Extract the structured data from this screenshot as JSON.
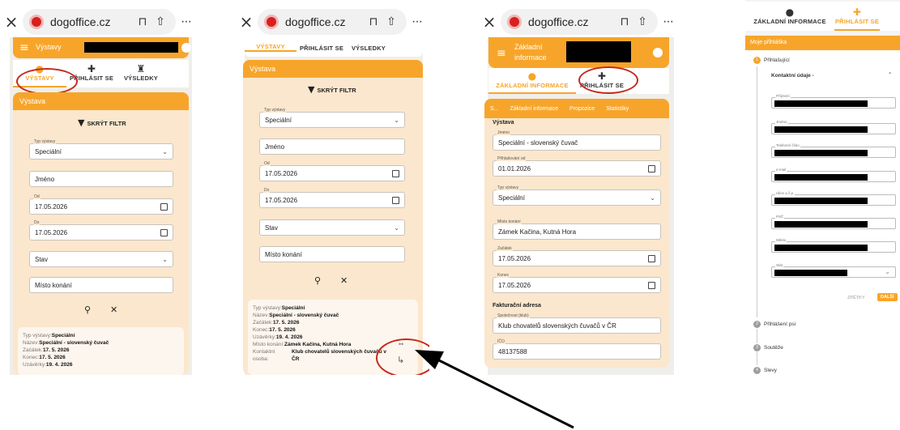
{
  "browser": {
    "close": "×",
    "url": "dogoffice.cz",
    "bookmark": "⊓",
    "share": "⇧",
    "more": "···"
  },
  "tabs": {
    "vystavy": "VÝSTAVY",
    "prihlasit": "PŘIHLÁSIT SE",
    "vysledky": "VÝSLEDKY",
    "zakladni": "ZÁKLADNÍ INFORMACE"
  },
  "panel1": {
    "header_title": "Výstavy",
    "card_title": "Výstava",
    "filter_label": "SKRÝT FILTR",
    "type_label": "Typ výstavy",
    "type_value": "Speciální",
    "name_placeholder": "Jméno",
    "from_label": "Od",
    "from_value": "17.05.2026",
    "to_label": "Do",
    "to_value": "17.05.2026",
    "state_value": "Stav",
    "place_placeholder": "Místo konání",
    "result": {
      "k1": "Typ výstavy:",
      "v1": "Speciální",
      "k2": "Název:",
      "v2": "Speciální - slovenský čuvač",
      "k3": "Začátek:",
      "v3": "17. 5. 2026",
      "k4": "Konec:",
      "v4": "17. 5. 2026",
      "k5": "Uzávěrky:",
      "v5": "19. 4. 2026"
    }
  },
  "panel2": {
    "card_title": "Výstava",
    "filter_label": "SKRÝT FILTR",
    "type_label": "Typ výstavy",
    "type_value": "Speciální",
    "name_placeholder": "Jméno",
    "from_label": "Od",
    "from_value": "17.05.2026",
    "to_label": "Do",
    "to_value": "17.05.2026",
    "state_value": "Stav",
    "place_placeholder": "Místo konání",
    "result": {
      "k1": "Typ výstavy:",
      "v1": "Speciální",
      "k2": "Název:",
      "v2": "Speciální - slovenský čuvač",
      "k3": "Začátek:",
      "v3": "17. 5. 2026",
      "k4": "Konec:",
      "v4": "17. 5. 2026",
      "k5": "Uzávěrky:",
      "v5": "19. 4. 2026",
      "k6": "Místo konání:",
      "v6": "Zámek Kačina, Kutná Hora",
      "k7": "Kontaktní osoba:",
      "v7": "Klub chovatelů slovenských čuvačů v ČR"
    }
  },
  "panel3": {
    "header_title_1": "Základní",
    "header_title_2": "informace",
    "subtab_s": "S...",
    "subtab_zakladni": "Základní informace",
    "subtab_propozice": "Propozice",
    "subtab_statistiky": "Statistiky",
    "section_vystava": "Výstava",
    "f_name_label": "Jméno",
    "f_name_value": "Speciální - slovenský čuvač",
    "f_reg_label": "Přihlašování od",
    "f_reg_value": "01.01.2026",
    "f_type_label": "Typ výstavy",
    "f_type_value": "Speciální",
    "f_place_label": "Místo konání",
    "f_place_value": "Zámek Kačina, Kutná Hora",
    "f_start_label": "Začátek",
    "f_start_value": "17.05.2026",
    "f_end_label": "Konec",
    "f_end_value": "17.05.2026",
    "section_fakt": "Fakturační adresa",
    "f_company_label": "Společnost (klub)",
    "f_company_value": "Klub chovatelů slovenských čuvačů v ČR",
    "f_ico_label": "IČO",
    "f_ico_value": "48137588"
  },
  "panel4": {
    "header_title": "Moje přihláška",
    "step1": "Přihlašující",
    "contact": "Kontaktní údaje -",
    "fields": [
      "Příjmení",
      "Jméno",
      "Telefonní číslo",
      "e-mail",
      "Ulice a č.p.",
      "PSČ",
      "Město",
      "Stát"
    ],
    "btn_back": "ZPĚTKY",
    "btn_next": "DALŠÍ",
    "step2": "Přihlášení psi",
    "step3": "Soutěže",
    "step4": "Slevy",
    "n2": "2",
    "n3": "3",
    "n4": "4",
    "n1": "1"
  },
  "colors": {
    "accent": "#f7a52a",
    "card": "#fbe7cd",
    "annotation": "#c52a1d"
  }
}
